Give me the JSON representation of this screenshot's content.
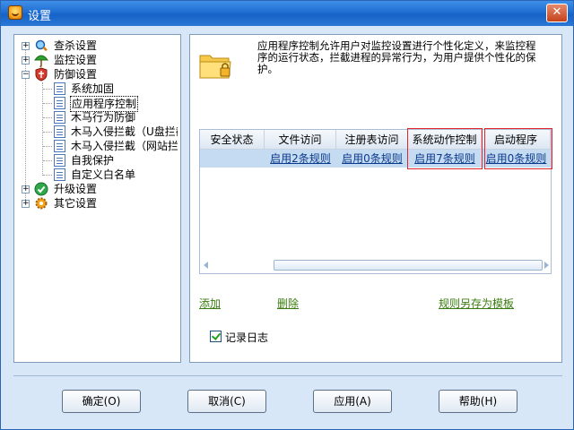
{
  "window": {
    "title": "设置",
    "close_label": "✕"
  },
  "tree": {
    "items": [
      {
        "label": "查杀设置",
        "expander": "+"
      },
      {
        "label": "监控设置",
        "expander": "+"
      },
      {
        "label": "防御设置",
        "expander": "−"
      },
      {
        "label": "系统加固"
      },
      {
        "label": "应用程序控制"
      },
      {
        "label": "木马行为防御"
      },
      {
        "label": "木马入侵拦截（U盘拦截"
      },
      {
        "label": "木马入侵拦截（网站拦"
      },
      {
        "label": "自我保护"
      },
      {
        "label": "自定义白名单"
      },
      {
        "label": "升级设置",
        "expander": "+"
      },
      {
        "label": "其它设置",
        "expander": "+"
      }
    ]
  },
  "panel": {
    "description": "应用程序控制允许用户对监控设置进行个性化定义，来监控程序的运行状态，拦截进程的异常行为，为用户提供个性化的保护。",
    "columns": [
      "安全状态",
      "文件访问",
      "注册表访问",
      "系统动作控制",
      "启动程序"
    ],
    "row": [
      "",
      "启用2条规则",
      "启用0条规则",
      "启用7条规则",
      "启用0条规则"
    ],
    "links": {
      "add": "添加",
      "delete": "删除",
      "save_template": "规则另存为模板"
    },
    "log_checkbox": "记录日志"
  },
  "buttons": {
    "ok": "确定(O)",
    "cancel": "取消(C)",
    "apply": "应用(A)",
    "help": "帮助(H)"
  },
  "colors": {
    "titlebar": "#1f6ed2",
    "selection": "#c5dbf2",
    "highlight_border": "#e0262c",
    "link": "#3a7c0f"
  }
}
